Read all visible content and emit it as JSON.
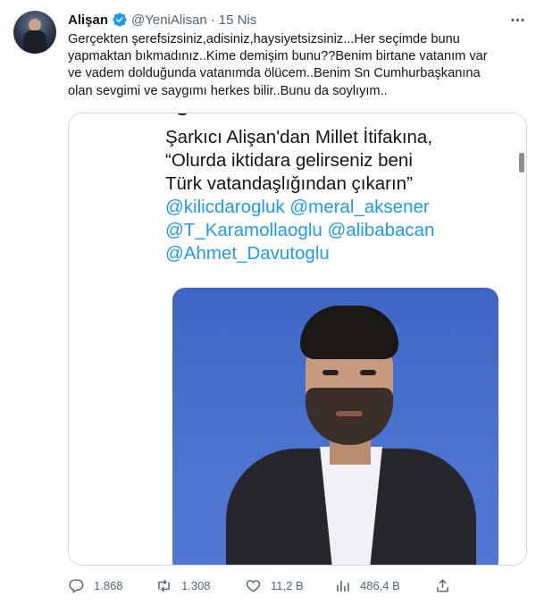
{
  "tweet": {
    "display_name": "Alişan",
    "handle": "@YeniAlisan",
    "separator": "·",
    "date": "15 Nis",
    "verified_color": "#1d9bf0",
    "text_lines": [
      "Gerçekten şerefsizsiniz,adisiniz,haysiyetsizsiniz...Her seçimde bunu",
      "yapmaktan bıkmadınız..Kime demişim bunu??Benim birtane vatanım var",
      "ve vadem dolduğunda vatanımda ölücem..Benim Sn Cumhurbaşkanına",
      "olan sevgimi ve saygımı herkes bilir..Bunu da soylıyım.."
    ]
  },
  "media": {
    "headline_lines": [
      "Şarkıcı Alişan'dan Millet İtifakına,",
      "“Olurda iktidara gelirseniz beni",
      "Türk vatandaşlığından çıkarın”"
    ],
    "mention_lines": [
      "@kilicdarogluk @meral_aksener",
      "@T_Karamollaoglu @alibabacan",
      "@Ahmet_Davutoglu"
    ],
    "photo_bg_color": "#4a73cf"
  },
  "actions": {
    "replies": "1.868",
    "retweets": "1.308",
    "likes": "11,2 B",
    "views": "486,4 B"
  },
  "icons": {
    "more": "more-dots-icon",
    "reply": "reply-icon",
    "retweet": "retweet-icon",
    "like": "heart-icon",
    "views": "views-chart-icon",
    "share": "share-icon",
    "verified": "verified-badge-icon"
  },
  "colors": {
    "text_primary": "#0f1419",
    "text_secondary": "#536471",
    "link": "#1d9bf0",
    "border": "#cfd9de"
  }
}
